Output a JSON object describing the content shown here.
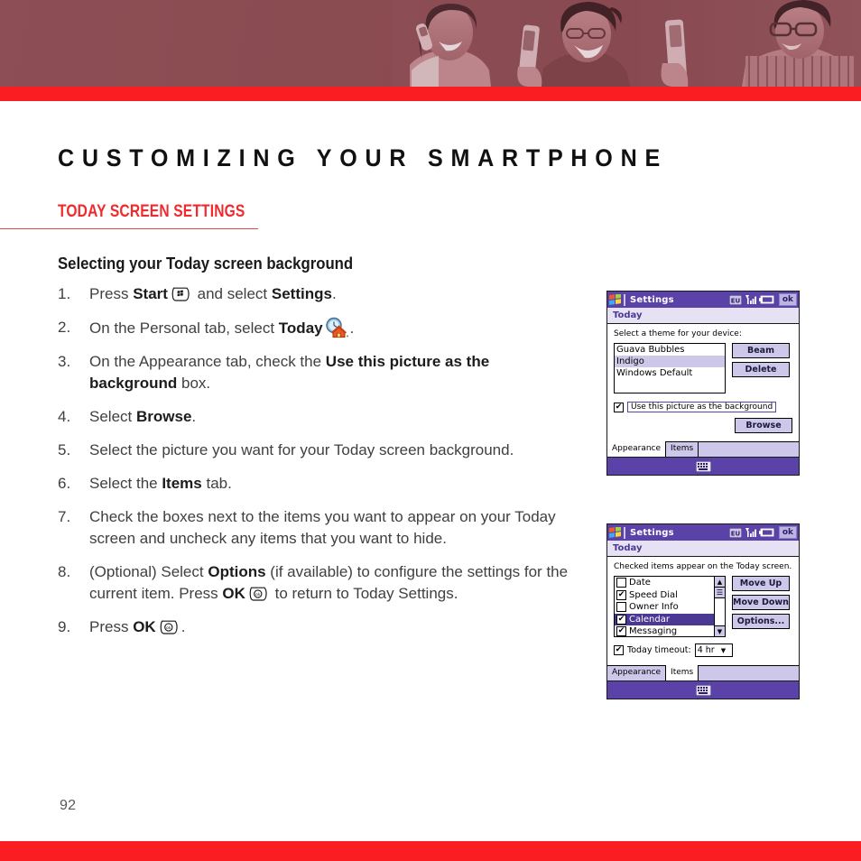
{
  "header": {
    "banner_alt": "three people smiling while using smartphones",
    "bar_color": "#fa1d22",
    "banner_color": "#8a4b51"
  },
  "chapter": {
    "title": "CUSTOMIZING YOUR SMARTPHONE"
  },
  "section": {
    "heading": "TODAY SCREEN SETTINGS",
    "heading_color": "#ef2b2d"
  },
  "body": {
    "subheading": "Selecting your Today screen background",
    "steps": [
      {
        "number": "1.",
        "parts": [
          {
            "t": "Press ",
            "b": false
          },
          {
            "t": "Start",
            "b": true
          },
          {
            "icon": "start-key-icon"
          },
          {
            "t": " and select ",
            "b": false
          },
          {
            "t": "Settings",
            "b": true
          },
          {
            "t": ".",
            "b": false
          }
        ]
      },
      {
        "number": "2.",
        "parts": [
          {
            "t": "On the Personal tab, select ",
            "b": false
          },
          {
            "t": "Today",
            "b": true
          },
          {
            "icon": "today-clock-house-icon"
          },
          {
            "t": ".",
            "b": false
          }
        ]
      },
      {
        "number": "3.",
        "parts": [
          {
            "t": "On the Appearance tab, check the ",
            "b": false
          },
          {
            "t": "Use this picture as the background",
            "b": true
          },
          {
            "t": " box.",
            "b": false
          }
        ]
      },
      {
        "number": "4.",
        "parts": [
          {
            "t": "Select ",
            "b": false
          },
          {
            "t": "Browse",
            "b": true
          },
          {
            "t": ".",
            "b": false
          }
        ]
      },
      {
        "number": "5.",
        "parts": [
          {
            "t": "Select the picture you want for your Today screen background.",
            "b": false
          }
        ]
      },
      {
        "number": "6.",
        "parts": [
          {
            "t": "Select the ",
            "b": false
          },
          {
            "t": "Items",
            "b": true
          },
          {
            "t": " tab.",
            "b": false
          }
        ]
      },
      {
        "number": "7.",
        "parts": [
          {
            "t": "Check the boxes next to the items you want to appear on your Today screen and uncheck any items that you want to hide.",
            "b": false
          }
        ]
      },
      {
        "number": "8.",
        "parts": [
          {
            "t": "(Optional) Select ",
            "b": false
          },
          {
            "t": "Options",
            "b": true
          },
          {
            "t": " (if available) to configure the settings for the current item. Press ",
            "b": false
          },
          {
            "t": "OK",
            "b": true
          },
          {
            "icon": "ok-key-icon"
          },
          {
            "t": " to return to Today Settings.",
            "b": false
          }
        ]
      },
      {
        "number": "9.",
        "parts": [
          {
            "t": "Press ",
            "b": false
          },
          {
            "t": "OK",
            "b": true
          },
          {
            "icon": "ok-key-icon"
          },
          {
            "t": ".",
            "b": false
          }
        ]
      }
    ]
  },
  "screenshot_appearance": {
    "titlebar": {
      "title": "Settings",
      "icons": [
        "eu-indicator-icon",
        "signal-strength-icon",
        "battery-icon"
      ],
      "ok_label": "ok"
    },
    "subbar": "Today",
    "prompt": "Select a theme for your device:",
    "themes": [
      {
        "label": "Guava Bubbles",
        "selected": false
      },
      {
        "label": "Indigo",
        "selected": true
      },
      {
        "label": "Windows Default",
        "selected": false
      }
    ],
    "buttons": [
      "Beam",
      "Delete"
    ],
    "checkbox": {
      "label": "Use this picture as the background",
      "checked": true,
      "mark": "✔"
    },
    "browse_button": "Browse",
    "tabs": [
      {
        "label": "Appearance",
        "active": true
      },
      {
        "label": "Items",
        "active": false
      }
    ]
  },
  "screenshot_items": {
    "titlebar": {
      "title": "Settings",
      "icons": [
        "eu-indicator-icon",
        "signal-strength-icon",
        "battery-icon"
      ],
      "ok_label": "ok"
    },
    "subbar": "Today",
    "prompt": "Checked items appear on the Today screen.",
    "items": [
      {
        "label": "Date",
        "checked": false,
        "selected": false
      },
      {
        "label": "Speed Dial",
        "checked": true,
        "selected": false
      },
      {
        "label": "Owner Info",
        "checked": false,
        "selected": false
      },
      {
        "label": "Calendar",
        "checked": true,
        "selected": true
      },
      {
        "label": "Messaging",
        "checked": true,
        "selected": false
      }
    ],
    "buttons": [
      "Move Up",
      "Move Down",
      "Options..."
    ],
    "timeout": {
      "label": "Today timeout:",
      "checked": true,
      "value": "4 hr"
    },
    "tabs": [
      {
        "label": "Appearance",
        "active": false
      },
      {
        "label": "Items",
        "active": true
      }
    ]
  },
  "footer": {
    "page_number": "92"
  }
}
